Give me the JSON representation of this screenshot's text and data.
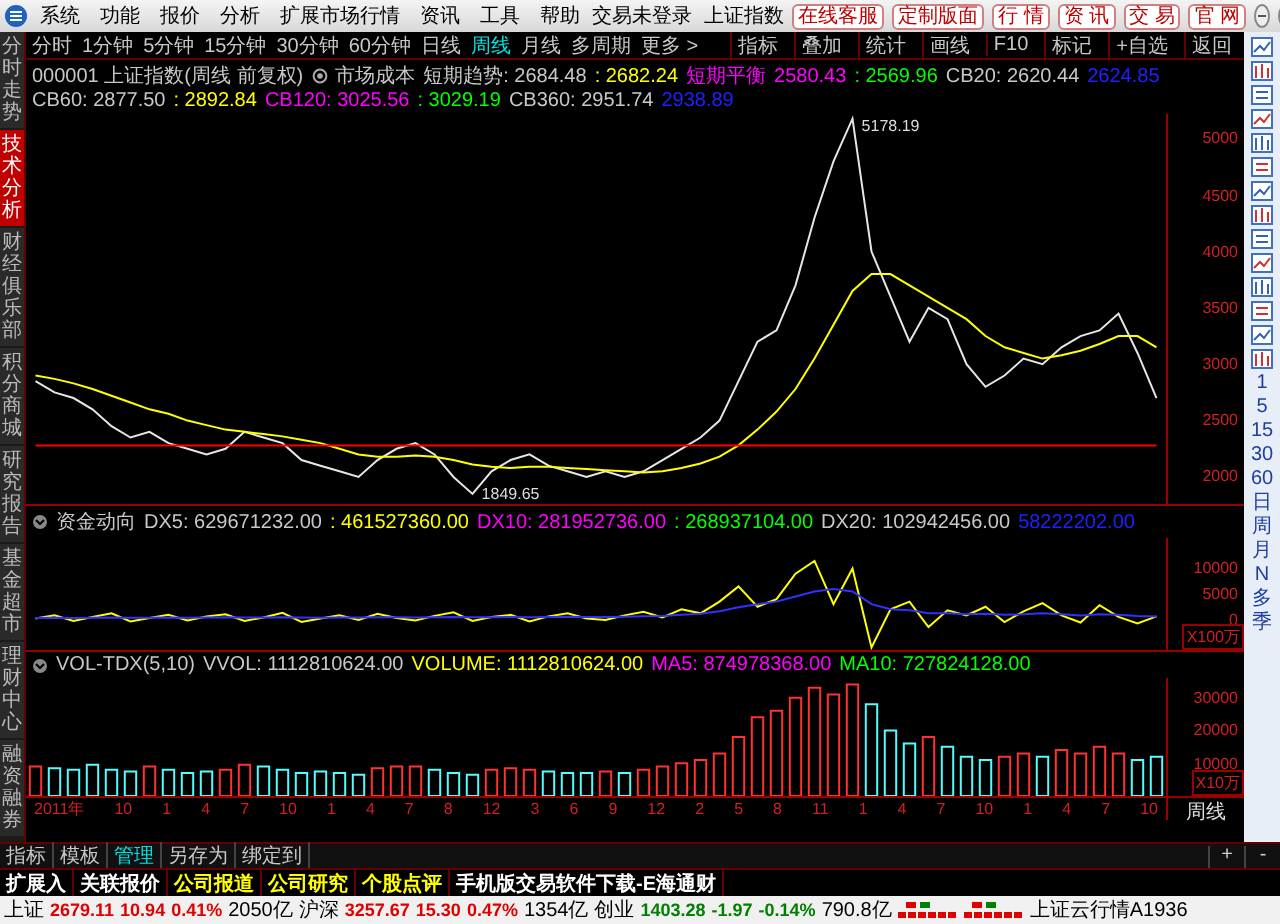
{
  "window": {
    "title": "交易未登录",
    "security": "上证指数"
  },
  "menu": [
    "系统",
    "功能",
    "报价",
    "分析",
    "扩展市场行情",
    "资讯",
    "工具",
    "帮助"
  ],
  "top_buttons": [
    "在线客服",
    "定制版面",
    "行 情",
    "资 讯",
    "交 易",
    "官 网"
  ],
  "left_tabs": [
    {
      "label": "分时走势",
      "selected": false
    },
    {
      "label": "技术分析",
      "selected": true
    },
    {
      "label": "财经俱乐部",
      "selected": false
    },
    {
      "label": "积分商城",
      "selected": false
    },
    {
      "label": "研究报告",
      "selected": false
    },
    {
      "label": "基金超市",
      "selected": false
    },
    {
      "label": "理财中心",
      "selected": false
    },
    {
      "label": "融资融券",
      "selected": false
    }
  ],
  "periods": [
    {
      "label": "分时",
      "selected": false
    },
    {
      "label": "1分钟",
      "selected": false
    },
    {
      "label": "5分钟",
      "selected": false
    },
    {
      "label": "15分钟",
      "selected": false
    },
    {
      "label": "30分钟",
      "selected": false
    },
    {
      "label": "60分钟",
      "selected": false
    },
    {
      "label": "日线",
      "selected": false
    },
    {
      "label": "周线",
      "selected": true
    },
    {
      "label": "月线",
      "selected": false
    },
    {
      "label": "多周期",
      "selected": false
    },
    {
      "label": "更多 >",
      "selected": false
    }
  ],
  "chart_tools": [
    "指标",
    "叠加",
    "统计",
    "画线",
    "F10",
    "标记",
    "+自选",
    "返回"
  ],
  "main_panel": {
    "header": [
      {
        "text": "000001 上证指数(周线 前复权)",
        "color": "#c8c8c8"
      },
      {
        "text": "市场成本",
        "color": "#c8c8c8"
      },
      {
        "text": "短期趋势: 2684.48",
        "color": "#c8c8c8"
      },
      {
        "text": ": 2682.24",
        "color": "#ffff00"
      },
      {
        "text": "短期平衡",
        "color": "#ff00ff"
      },
      {
        "text": "2580.43",
        "color": "#ff00ff"
      },
      {
        "text": ": 2569.96",
        "color": "#00ff00"
      },
      {
        "text": "CB20: 2620.44",
        "color": "#c8c8c8"
      },
      {
        "text": "2624.85",
        "color": "#2020ff"
      },
      {
        "text": "CB60: 2877.50",
        "color": "#c8c8c8"
      },
      {
        "text": ": 2892.84",
        "color": "#ffff00"
      },
      {
        "text": "CB120: 3025.56",
        "color": "#ff00ff"
      },
      {
        "text": ": 3029.19",
        "color": "#00ff00"
      },
      {
        "text": "CB360: 2951.74",
        "color": "#c8c8c8"
      },
      {
        "text": "2938.89",
        "color": "#2020ff"
      }
    ],
    "chart_data": {
      "type": "line",
      "ylim": [
        1760,
        5220
      ],
      "yticks": [
        2000,
        2500,
        3000,
        3500,
        4000,
        4500,
        5000
      ],
      "series": [
        {
          "color": "#e6e6e6",
          "values": [
            2850,
            2750,
            2700,
            2600,
            2450,
            2350,
            2400,
            2300,
            2250,
            2200,
            2250,
            2400,
            2350,
            2300,
            2150,
            2100,
            2050,
            2000,
            2150,
            2250,
            2300,
            2200,
            2000,
            1849.65,
            2050,
            2150,
            2200,
            2100,
            2050,
            2000,
            2050,
            2000,
            2050,
            2150,
            2250,
            2350,
            2500,
            2850,
            3200,
            3300,
            3700,
            4300,
            4800,
            5178.19,
            4000,
            3600,
            3200,
            3500,
            3400,
            3000,
            2800,
            2900,
            3050,
            3000,
            3150,
            3250,
            3300,
            3450,
            3100,
            2700
          ]
        },
        {
          "color": "#ffff00",
          "values": [
            2900,
            2870,
            2830,
            2780,
            2720,
            2660,
            2600,
            2560,
            2500,
            2460,
            2420,
            2400,
            2380,
            2360,
            2330,
            2300,
            2250,
            2200,
            2180,
            2180,
            2190,
            2180,
            2150,
            2110,
            2090,
            2080,
            2090,
            2090,
            2080,
            2070,
            2060,
            2050,
            2040,
            2050,
            2080,
            2120,
            2180,
            2280,
            2420,
            2580,
            2780,
            3050,
            3350,
            3650,
            3800,
            3800,
            3700,
            3600,
            3500,
            3400,
            3250,
            3150,
            3100,
            3050,
            3080,
            3120,
            3180,
            3250,
            3250,
            3150
          ]
        },
        {
          "color": "#ff0000",
          "values": [
            2280,
            2280,
            2280,
            2280,
            2280,
            2280,
            2280,
            2280,
            2280,
            2280,
            2280,
            2280,
            2280,
            2280,
            2280,
            2280,
            2280,
            2280,
            2280,
            2280,
            2280,
            2280,
            2280,
            2280,
            2280,
            2280,
            2280,
            2280,
            2280,
            2280,
            2280,
            2280,
            2280,
            2280,
            2280,
            2280,
            2280,
            2280,
            2280,
            2280,
            2280,
            2280,
            2280,
            2280,
            2280,
            2280,
            2280,
            2280,
            2280,
            2280,
            2280,
            2280,
            2280,
            2280,
            2280,
            2280,
            2280,
            2280,
            2280,
            2280
          ]
        }
      ],
      "annotations": [
        "5178.19",
        "1849.65"
      ]
    }
  },
  "indicator_panel": {
    "header": [
      {
        "text": "资金动向",
        "color": "#c8c8c8"
      },
      {
        "text": "DX5: 629671232.00",
        "color": "#c8c8c8"
      },
      {
        "text": ": 461527360.00",
        "color": "#ffff00"
      },
      {
        "text": "DX10: 281952736.00",
        "color": "#ff00ff"
      },
      {
        "text": ": 268937104.00",
        "color": "#00ff00"
      },
      {
        "text": "DX20: 102942456.00",
        "color": "#c8c8c8"
      },
      {
        "text": "58222202.00",
        "color": "#2020ff"
      }
    ],
    "unit": "X100万",
    "chart_data": {
      "type": "line",
      "ylim": [
        -6000,
        16000
      ],
      "yticks": [
        0,
        5000,
        10000
      ],
      "series": [
        {
          "color": "#ffff00",
          "values": [
            200,
            800,
            -300,
            500,
            1200,
            -400,
            300,
            900,
            -200,
            600,
            1000,
            -300,
            400,
            1300,
            -500,
            200,
            800,
            -100,
            1100,
            300,
            -200,
            700,
            1400,
            -300,
            500,
            900,
            -400,
            600,
            1200,
            200,
            -100,
            800,
            1500,
            400,
            2000,
            1200,
            3500,
            6500,
            2500,
            4000,
            9000,
            11500,
            3000,
            10000,
            -5500,
            2000,
            3500,
            -1500,
            1800,
            800,
            2500,
            -500,
            1600,
            3200,
            800,
            -600,
            2800,
            500,
            -800,
            600
          ]
        },
        {
          "color": "#3030ff",
          "values": [
            300,
            350,
            300,
            350,
            400,
            350,
            350,
            400,
            350,
            400,
            450,
            400,
            400,
            450,
            400,
            350,
            400,
            400,
            450,
            450,
            400,
            450,
            500,
            450,
            450,
            500,
            450,
            500,
            550,
            500,
            500,
            550,
            650,
            700,
            900,
            1100,
            1600,
            2400,
            3000,
            3500,
            4500,
            5500,
            6000,
            5500,
            3000,
            2000,
            1800,
            1200,
            1200,
            1000,
            1100,
            900,
            1000,
            1200,
            1000,
            800,
            1000,
            900,
            700,
            600
          ]
        }
      ]
    }
  },
  "volume_panel": {
    "header": [
      {
        "text": "VOL-TDX(5,10)",
        "color": "#c8c8c8"
      },
      {
        "text": "VVOL: 1112810624.00",
        "color": "#c8c8c8"
      },
      {
        "text": "VOLUME: 1112810624.00",
        "color": "#ffff00"
      },
      {
        "text": "MA5: 874978368.00",
        "color": "#ff00ff"
      },
      {
        "text": "MA10: 727824128.00",
        "color": "#00ff00"
      }
    ],
    "unit": "X10万",
    "chart_data": {
      "type": "bar",
      "ylim": [
        0,
        36000
      ],
      "yticks": [
        10000,
        20000,
        30000
      ],
      "series": [
        {
          "color": "#ff3232",
          "values": [
            9000,
            null,
            null,
            null,
            null,
            null,
            9000,
            null,
            null,
            null,
            8000,
            9500,
            null,
            null,
            null,
            null,
            null,
            null,
            8500,
            9000,
            9000,
            null,
            null,
            null,
            8000,
            8500,
            8000,
            null,
            null,
            null,
            7500,
            null,
            8000,
            9000,
            10000,
            11000,
            13000,
            18000,
            24000,
            26000,
            30000,
            33000,
            31000,
            34000,
            null,
            null,
            null,
            18000,
            null,
            null,
            null,
            12000,
            13000,
            null,
            14000,
            13000,
            15000,
            13000,
            null,
            null
          ]
        },
        {
          "color": "#54fcfc",
          "values": [
            null,
            8500,
            8000,
            9500,
            8000,
            7500,
            null,
            8000,
            7000,
            7500,
            null,
            null,
            9000,
            8000,
            7000,
            7500,
            7000,
            6500,
            null,
            null,
            null,
            8000,
            7000,
            6500,
            null,
            null,
            null,
            7500,
            7000,
            7000,
            null,
            7000,
            null,
            null,
            null,
            null,
            null,
            null,
            null,
            null,
            null,
            null,
            null,
            null,
            28000,
            20000,
            16000,
            null,
            15000,
            12000,
            11000,
            null,
            null,
            12000,
            null,
            null,
            null,
            null,
            11000,
            12000
          ]
        }
      ]
    }
  },
  "x_axis": {
    "labels": [
      "2011年",
      "10",
      "1",
      "4",
      "7",
      "10",
      "1",
      "4",
      "7",
      "8",
      "12",
      "3",
      "6",
      "9",
      "12",
      "2",
      "5",
      "8",
      "11",
      "1",
      "4",
      "7",
      "10",
      "1",
      "4",
      "7",
      "10"
    ],
    "period": "周线"
  },
  "right_toolbar": [
    "1",
    "5",
    "15",
    "30",
    "60",
    "日",
    "周",
    "月",
    "N",
    "多",
    "季"
  ],
  "bottom_tabs": [
    {
      "label": "指标",
      "selected": false
    },
    {
      "label": "模板",
      "selected": false
    },
    {
      "label": "管理",
      "selected": true
    },
    {
      "label": "另存为",
      "selected": false
    },
    {
      "label": "绑定到",
      "selected": false
    }
  ],
  "bottom_buttons": [
    "+",
    "-"
  ],
  "info_tabs": [
    {
      "label": "扩展入",
      "highlighted": false
    },
    {
      "label": "关联报价",
      "highlighted": false
    },
    {
      "label": "公司报道",
      "highlighted": true
    },
    {
      "label": "公司研究",
      "highlighted": true
    },
    {
      "label": "个股点评",
      "highlighted": true
    },
    {
      "label": "手机版交易软件下载-E海通财",
      "highlighted": false
    }
  ],
  "status": {
    "indices": [
      {
        "name": "上证",
        "value": "2679.11",
        "change": "10.94",
        "percent": "0.41%",
        "amount": "2050亿",
        "color": "#e00000"
      },
      {
        "name": "沪深",
        "value": "3257.67",
        "change": "15.30",
        "percent": "0.47%",
        "amount": "1354亿",
        "color": "#e00000"
      },
      {
        "name": "创业",
        "value": "1403.28",
        "change": "-1.97",
        "percent": "-0.14%",
        "amount": "790.8亿",
        "color": "#008000"
      }
    ],
    "cloud": "上证云行情A1936"
  }
}
